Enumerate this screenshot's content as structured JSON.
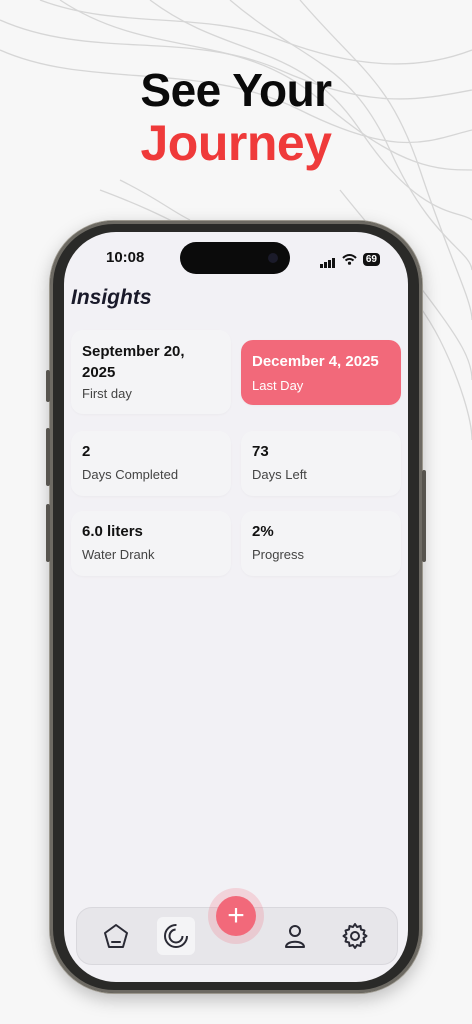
{
  "hero": {
    "line1": "See Your",
    "line2": "Journey"
  },
  "status": {
    "time": "10:08",
    "battery": "69"
  },
  "page": {
    "title": "Insights"
  },
  "cards": [
    {
      "value": "September 20, 2025",
      "label": "First day"
    },
    {
      "value": "December 4, 2025",
      "label": "Last Day",
      "highlight": true
    },
    {
      "value": "2",
      "label": "Days Completed"
    },
    {
      "value": "73",
      "label": "Days Left"
    },
    {
      "value": "6.0 liters",
      "label": "Water Drank"
    },
    {
      "value": "2%",
      "label": "Progress"
    }
  ],
  "tabbar": {
    "items": [
      "home-icon",
      "progress-ring-icon",
      "add-icon",
      "profile-icon",
      "settings-icon"
    ],
    "active": "progress-ring-icon",
    "fab_label": "+"
  },
  "colors": {
    "accent": "#F2697A",
    "hero_red": "#EF3A3A",
    "background": "#F2F1F5"
  }
}
